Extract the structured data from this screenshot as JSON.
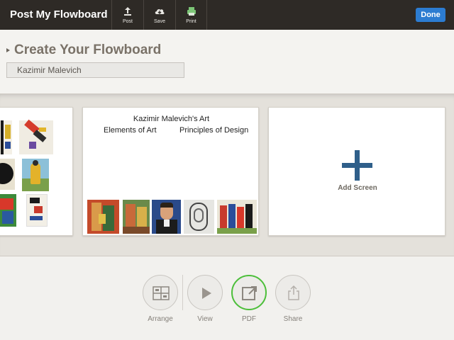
{
  "topbar": {
    "title": "Post My Flowboard",
    "buttons": [
      {
        "label": "Post",
        "icon": "upload-icon"
      },
      {
        "label": "Save",
        "icon": "cloud-save-icon"
      },
      {
        "label": "Print",
        "icon": "printer-icon"
      }
    ],
    "done_label": "Done",
    "accent": "#2c7cd1"
  },
  "header": {
    "title": "Create Your Flowboard",
    "name_value": "Kazimir Malevich"
  },
  "cards": {
    "middle": {
      "title": "Kazimir Malevich's Art",
      "subtitle_left": "Elements of Art",
      "subtitle_right": "Principles of Design"
    },
    "add": {
      "label": "Add Screen",
      "icon": "plus-icon"
    }
  },
  "tools": [
    {
      "label": "Arrange",
      "icon": "arrange-icon"
    },
    {
      "label": "View",
      "icon": "play-icon"
    },
    {
      "label": "PDF",
      "icon": "export-icon",
      "active": true
    },
    {
      "label": "Share",
      "icon": "share-icon"
    }
  ]
}
